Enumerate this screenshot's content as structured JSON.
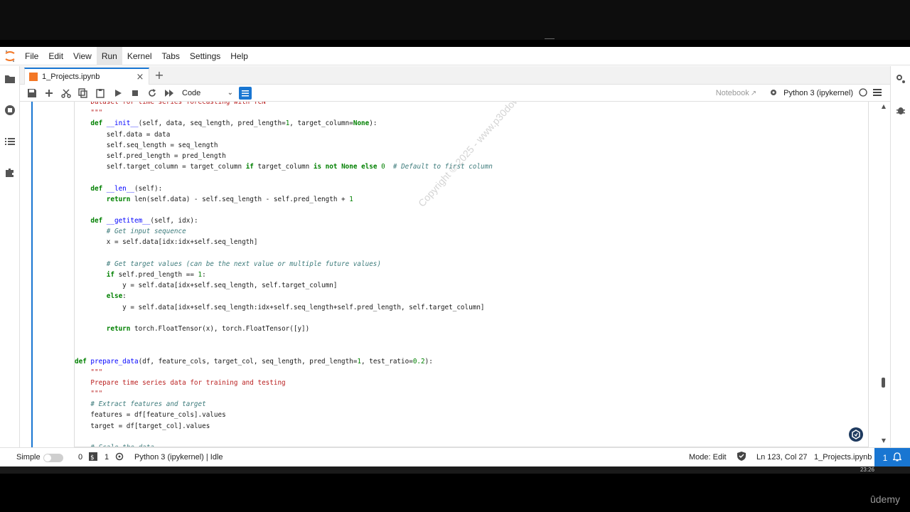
{
  "menu": {
    "items": [
      "File",
      "Edit",
      "View",
      "Run",
      "Kernel",
      "Tabs",
      "Settings",
      "Help"
    ],
    "active": "Run"
  },
  "tab": {
    "label": "1_Projects.ipynb",
    "close": "×",
    "new": "+"
  },
  "toolbar": {
    "cell_type": "Code",
    "notebook_link": "Notebook",
    "kernel": "Python 3 (ipykernel)"
  },
  "code_lines": [
    "    Dataset for time series forecasting with TCN",
    "    \"\"\"",
    "    def __init__(self, data, seq_length, pred_length=1, target_column=None):",
    "        self.data = data",
    "        self.seq_length = seq_length",
    "        self.pred_length = pred_length",
    "        self.target_column = target_column if target_column is not None else 0  # Default to first column",
    "",
    "    def __len__(self):",
    "        return len(self.data) - self.seq_length - self.pred_length + 1",
    "",
    "    def __getitem__(self, idx):",
    "        # Get input sequence",
    "        x = self.data[idx:idx+self.seq_length]",
    "",
    "        # Get target values (can be the next value or multiple future values)",
    "        if self.pred_length == 1:",
    "            y = self.data[idx+self.seq_length, self.target_column]",
    "        else:",
    "            y = self.data[idx+self.seq_length:idx+self.seq_length+self.pred_length, self.target_column]",
    "",
    "        return torch.FloatTensor(x), torch.FloatTensor([y])",
    "",
    "",
    "def prepare_data(df, feature_cols, target_col, seq_length, pred_length=1, test_ratio=0.2):",
    "    \"\"\"",
    "    Prepare time series data for training and testing",
    "    \"\"\"",
    "    # Extract features and target",
    "    features = df[feature_cols].values",
    "    target = df[target_col].values",
    "",
    "    # Scale the data"
  ],
  "watermark": "Copyright © 2025 - www.p30download.com",
  "status": {
    "mode_label": "Simple",
    "count_a": "0",
    "count_b": "1",
    "kernel_status": "Python 3 (ipykernel) | Idle",
    "mode": "Mode: Edit",
    "position": "Ln 123, Col 27",
    "file": "1_Projects.ipynb",
    "notifications": "1"
  },
  "taskbar": {
    "clock": "23:26"
  },
  "brand": "ûdemy",
  "colors": {
    "accent": "#1976d2",
    "keyword": "#008000",
    "string": "#ba2121",
    "comment": "#3d7b7b"
  }
}
